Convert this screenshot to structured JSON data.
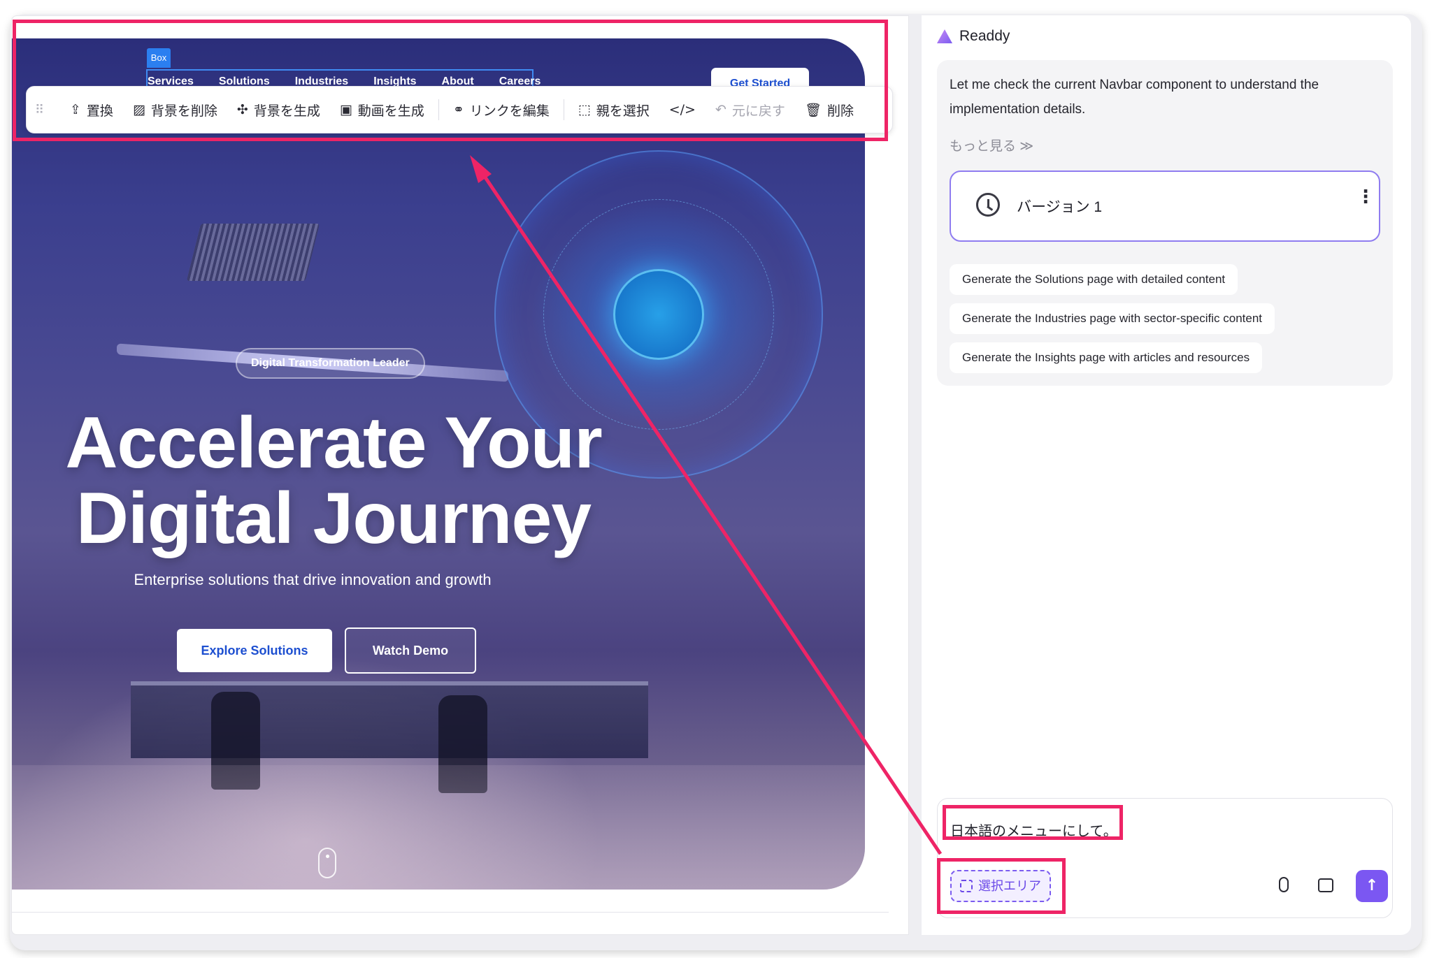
{
  "navbar": {
    "box_tag": "Box",
    "links": [
      "Services",
      "Solutions",
      "Industries",
      "Insights",
      "About",
      "Careers"
    ],
    "cta": "Get Started"
  },
  "toolbar": {
    "items": [
      {
        "icon": "upload-icon",
        "glyph": "⇪",
        "label": "置換"
      },
      {
        "icon": "remove-background-icon",
        "glyph": "▨",
        "label": "背景を削除"
      },
      {
        "icon": "generate-background-icon",
        "glyph": "✣",
        "label": "背景を生成"
      },
      {
        "icon": "generate-video-icon",
        "glyph": "▣",
        "label": "動画を生成"
      },
      {
        "icon": "link-icon",
        "glyph": "⚭",
        "label": "リンクを編集"
      },
      {
        "icon": "select-parent-icon",
        "glyph": "⬚",
        "label": "親を選択"
      },
      {
        "icon": "code-icon",
        "glyph": "</>",
        "label": ""
      },
      {
        "icon": "undo-icon",
        "glyph": "↶",
        "label": "元に戻す"
      },
      {
        "icon": "trash-icon",
        "glyph": "🗑",
        "label": "削除"
      }
    ]
  },
  "hero": {
    "tag": "Digital Transformation Leader",
    "headline_line1": "Accelerate Your",
    "headline_line2": "Digital Journey",
    "subheadline": "Enterprise solutions that drive innovation and growth",
    "primary_button": "Explore Solutions",
    "secondary_button": "Watch Demo"
  },
  "chat": {
    "brand": "Readdy",
    "message": "Let me check the current Navbar component to understand the implementation details.",
    "more": "もっと見る ≫",
    "version_label": "バージョン 1",
    "version_menu": "⋮",
    "suggestions": [
      "Generate the Solutions page with detailed content",
      "Generate the Industries page with sector-specific content",
      "Generate the Insights page with articles and resources"
    ],
    "input_text": "日本語のメニューにして。",
    "area_chip": "選択エリア",
    "send_glyph": "↑"
  },
  "colors": {
    "annotation": "#ee2466",
    "accent": "#7b57f2",
    "primary_blue": "#1d4fd0"
  }
}
